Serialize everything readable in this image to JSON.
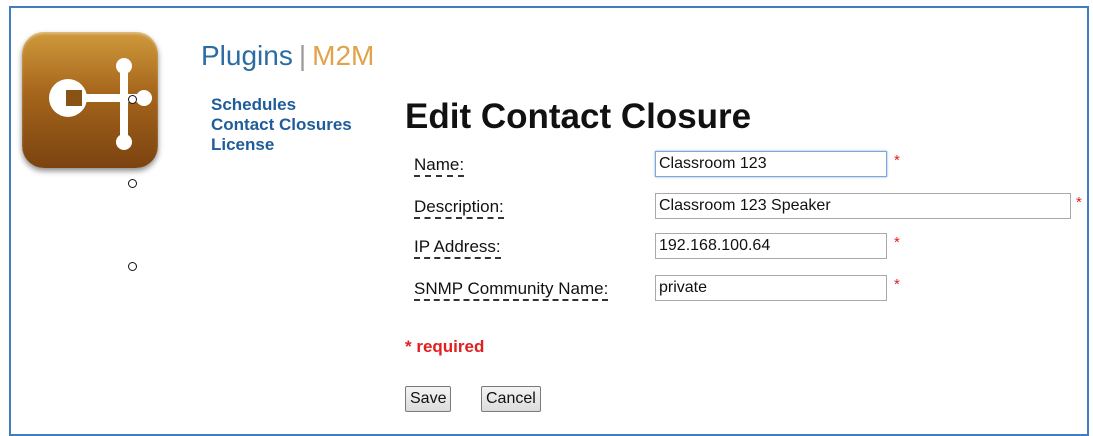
{
  "header": {
    "title": "Plugins",
    "separator": "|",
    "subtitle": "M2M"
  },
  "logo": {
    "icon": "contact-closure-plugin-icon",
    "color": "#a5651b"
  },
  "nav": {
    "items": [
      {
        "label": "Schedules"
      },
      {
        "label": "Contact Closures"
      },
      {
        "label": "License"
      }
    ]
  },
  "page": {
    "title": "Edit Contact Closure"
  },
  "form": {
    "name": {
      "label": "Name:",
      "value": "Classroom 123",
      "required": "*"
    },
    "description": {
      "label": "Description:",
      "value": "Classroom 123 Speaker",
      "required": "*"
    },
    "ip": {
      "label": "IP Address:",
      "value": "192.168.100.64",
      "required": "*"
    },
    "snmp": {
      "label": "SNMP Community Name:",
      "value": "private",
      "required": "*"
    }
  },
  "required_note": "* required",
  "buttons": {
    "save": "Save",
    "cancel": "Cancel"
  },
  "colors": {
    "frame": "#3f7fc1",
    "link": "#1f5c9a",
    "accent": "#e0a24a",
    "required": "#e02020"
  }
}
